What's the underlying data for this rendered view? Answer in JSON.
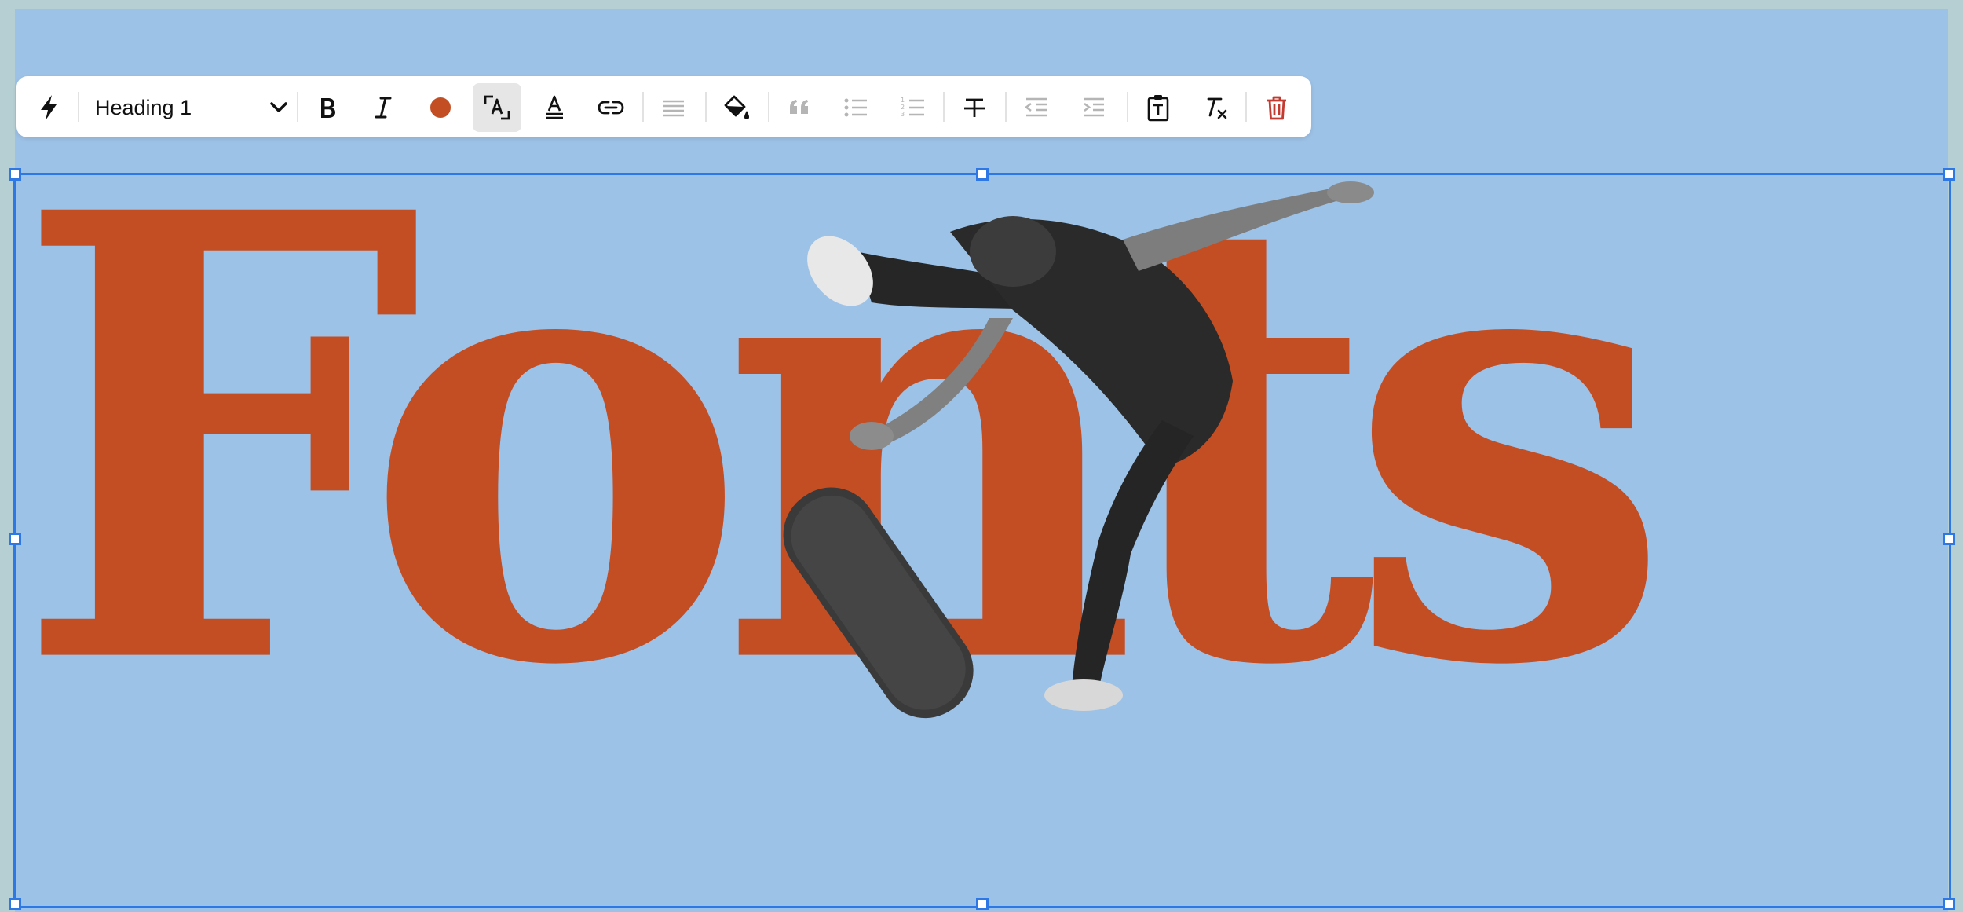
{
  "toolbar": {
    "text_style": "Heading 1",
    "text_color": "#c34e24",
    "delete_color": "#c23b31",
    "icons": [
      "lightning-icon",
      "chevron-down-icon",
      "bold-icon",
      "italic-icon",
      "text-color-icon",
      "font-size-icon",
      "text-highlight-icon",
      "link-icon",
      "align-icon",
      "fill-icon",
      "quote-icon",
      "bulleted-list-icon",
      "numbered-list-icon",
      "strikethrough-icon",
      "outdent-icon",
      "indent-icon",
      "text-box-icon",
      "clear-formatting-icon",
      "trash-icon"
    ]
  },
  "canvas": {
    "heading": "Fonts",
    "background": "#9dc2e7",
    "selection_color": "#2d78e5"
  }
}
